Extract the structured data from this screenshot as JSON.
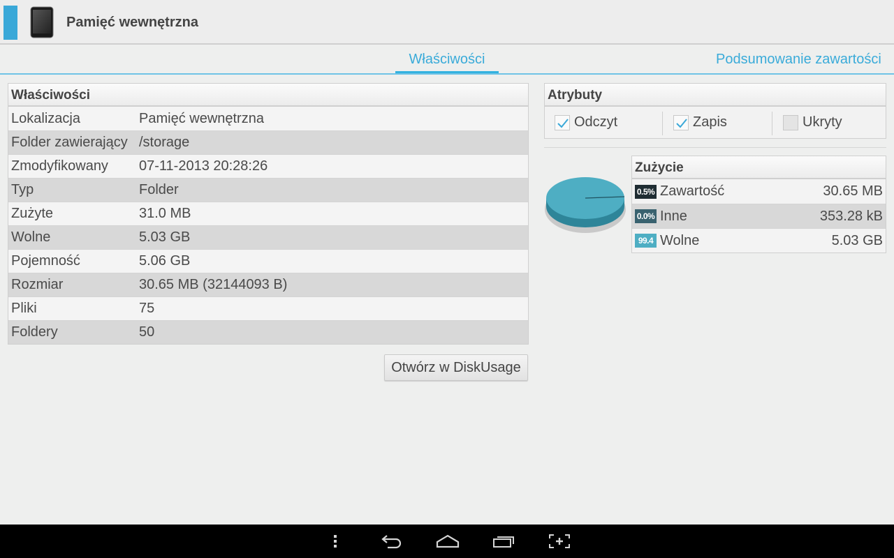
{
  "header": {
    "title": "Pamięć wewnętrzna",
    "accent": "#3aa8d8"
  },
  "tabs": [
    {
      "label": "Właściwości",
      "active": true
    },
    {
      "label": "Podsumowanie zawartości",
      "active": false
    }
  ],
  "properties": {
    "title": "Właściwości",
    "rows": [
      {
        "key": "Lokalizacja",
        "value": "Pamięć wewnętrzna"
      },
      {
        "key": "Folder zawierający",
        "value": "/storage"
      },
      {
        "key": "Zmodyfikowany",
        "value": "07-11-2013 20:28:26"
      },
      {
        "key": "Typ",
        "value": "Folder"
      },
      {
        "key": "Zużyte",
        "value": "31.0 MB"
      },
      {
        "key": "Wolne",
        "value": "5.03 GB"
      },
      {
        "key": "Pojemność",
        "value": "5.06 GB"
      },
      {
        "key": "Rozmiar",
        "value": "30.65 MB (32144093 B)"
      },
      {
        "key": "Pliki",
        "value": "75"
      },
      {
        "key": "Foldery",
        "value": "50"
      }
    ],
    "open_button": "Otwórz w DiskUsage"
  },
  "attributes": {
    "title": "Atrybuty",
    "items": [
      {
        "label": "Odczyt",
        "checked": true
      },
      {
        "label": "Zapis",
        "checked": true
      },
      {
        "label": "Ukryty",
        "checked": false
      }
    ]
  },
  "usage": {
    "title": "Zużycie",
    "rows": [
      {
        "badge": "0.5%",
        "badge_color": "#1f2d33",
        "name": "Zawartość",
        "size": "30.65 MB",
        "percent": 0.5
      },
      {
        "badge": "0.0%",
        "badge_color": "#39626f",
        "name": "Inne",
        "size": "353.28 kB",
        "percent": 0.0
      },
      {
        "badge": "99.4",
        "badge_color": "#4eaec3",
        "name": "Wolne",
        "size": "5.03 GB",
        "percent": 99.4
      }
    ]
  },
  "colors": {
    "pie_main": "#4eaec3",
    "pie_side": "#2e8599",
    "tab_accent": "#33b2e0"
  },
  "nav": [
    "menu-icon",
    "back-icon",
    "home-icon",
    "recent-apps-icon",
    "screenshot-icon"
  ]
}
